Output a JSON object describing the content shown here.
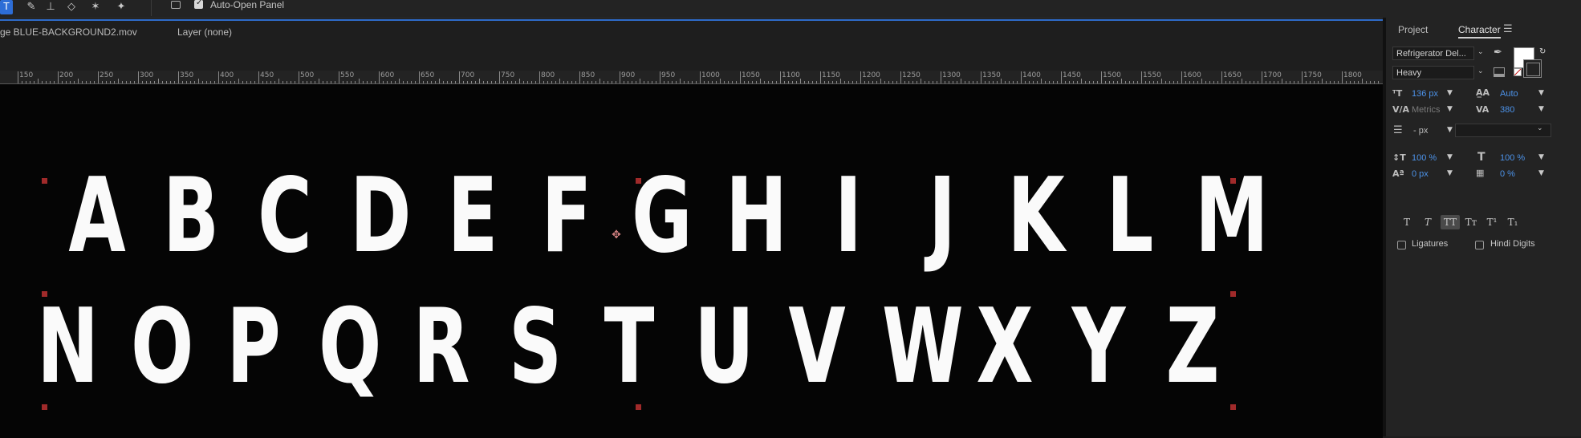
{
  "toolbar": {
    "tools": [
      {
        "icon": "type-tool-icon",
        "glyph": "T",
        "active": true
      },
      {
        "icon": "brush-tool-icon",
        "glyph": "✎"
      },
      {
        "icon": "clone-stamp-icon",
        "glyph": "⊥"
      },
      {
        "icon": "eraser-icon",
        "glyph": "◇"
      },
      {
        "icon": "roto-brush-icon",
        "glyph": "✶"
      },
      {
        "icon": "puppet-pin-icon",
        "glyph": "✦"
      }
    ],
    "auto_open_panel_label": "Auto-Open Panel",
    "auto_open_panel_checked": true
  },
  "viewer": {
    "footage_tab": "ge BLUE-BACKGROUND2.mov",
    "layer_tab": "Layer (none)",
    "ruler_labels": [
      "150",
      "200",
      "250",
      "300",
      "350",
      "400",
      "450",
      "500",
      "550",
      "600",
      "650",
      "700",
      "750",
      "800",
      "850",
      "900",
      "950",
      "1000",
      "1050",
      "1100",
      "1150",
      "1200",
      "1250",
      "1300",
      "1350",
      "1400",
      "1450",
      "1500",
      "1550",
      "1600",
      "1650",
      "1700",
      "1750",
      "1800"
    ],
    "row1_letters": [
      "A",
      "B",
      "C",
      "D",
      "E",
      "F",
      "G",
      "H",
      "I",
      "J",
      "K",
      "L",
      "M"
    ],
    "row2_letters": [
      "N",
      "O",
      "P",
      "Q",
      "R",
      "S",
      "T",
      "U",
      "V",
      "W",
      "X",
      "Y",
      "Z"
    ]
  },
  "panel": {
    "tabs": {
      "project": "Project",
      "character": "Character"
    },
    "font_family": "Refrigerator Del...",
    "font_style": "Heavy",
    "font_size": "136 px",
    "leading": "Auto",
    "kerning": "Metrics",
    "tracking": "380",
    "stroke_width": "- px",
    "vertical_scale": "100 %",
    "horizontal_scale": "100 %",
    "baseline_shift": "0 px",
    "tsume": "0 %",
    "style_buttons": [
      "T",
      "T",
      "TT",
      "Tт",
      "T¹",
      "T₁"
    ],
    "ligatures_label": "Ligatures",
    "hindi_digits_label": "Hindi Digits",
    "fill_color": "#ffffff",
    "stroke_color": "#000000"
  }
}
